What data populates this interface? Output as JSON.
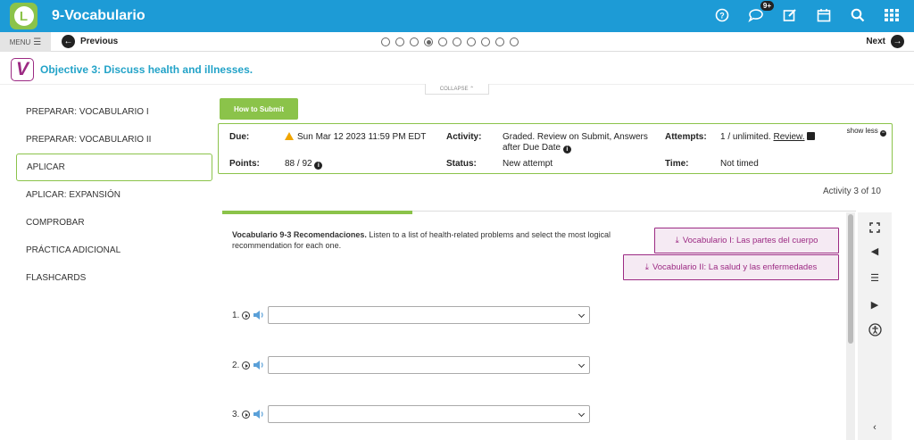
{
  "header": {
    "app_title": "9-Vocabulario",
    "logo_letter": "L",
    "notification_count": "9+",
    "icons": [
      "help-icon",
      "messages-icon",
      "edit-icon",
      "calendar-icon",
      "search-icon",
      "apps-grid-icon"
    ]
  },
  "nav": {
    "menu_label": "MENU",
    "previous_label": "Previous",
    "next_label": "Next",
    "page_dots": 10,
    "active_dot": 4
  },
  "objective": {
    "badge": "V",
    "title": "Objective 3: Discuss health and illnesses."
  },
  "collapse_label": "COLLAPSE",
  "sidebar": {
    "items": [
      {
        "label": "PREPARAR: VOCABULARIO I"
      },
      {
        "label": "PREPARAR: VOCABULARIO II"
      },
      {
        "label": "APLICAR"
      },
      {
        "label": "APLICAR: EXPANSIÓN"
      },
      {
        "label": "COMPROBAR"
      },
      {
        "label": "PRÁCTICA ADICIONAL"
      },
      {
        "label": "FLASHCARDS"
      }
    ],
    "active_index": 2
  },
  "how_to_submit": "How to Submit",
  "info": {
    "due_label": "Due:",
    "due_value": "Sun Mar 12 2023 11:59 PM EDT",
    "activity_label": "Activity:",
    "activity_value_1": "Graded. Review on Submit, Answers",
    "activity_value_2": "after Due Date",
    "attempts_label": "Attempts:",
    "attempts_value": "1 / unlimited.",
    "review_link": "Review.",
    "show_less": "show less",
    "points_label": "Points:",
    "points_value": "88 / 92",
    "status_label": "Status:",
    "status_value": "New attempt",
    "time_label": "Time:",
    "time_value": "Not timed"
  },
  "activity_count": "Activity 3 of 10",
  "exercise": {
    "title": "Vocabulario 9-3 Recomendaciones.",
    "instructions": " Listen to a list of health-related problems and select the most logical recommendation for each one.",
    "vocab_button_1": "Vocabulario I: Las partes del cuerpo",
    "vocab_button_2": "Vocabulario II: La salud y las enfermedades",
    "questions": [
      {
        "number": "1."
      },
      {
        "number": "2."
      },
      {
        "number": "3."
      }
    ]
  },
  "colors": {
    "header_blue": "#1d9bd6",
    "accent_green": "#8bc34a",
    "vocab_purple": "#9c2a83",
    "objective_blue": "#23a3c8"
  }
}
